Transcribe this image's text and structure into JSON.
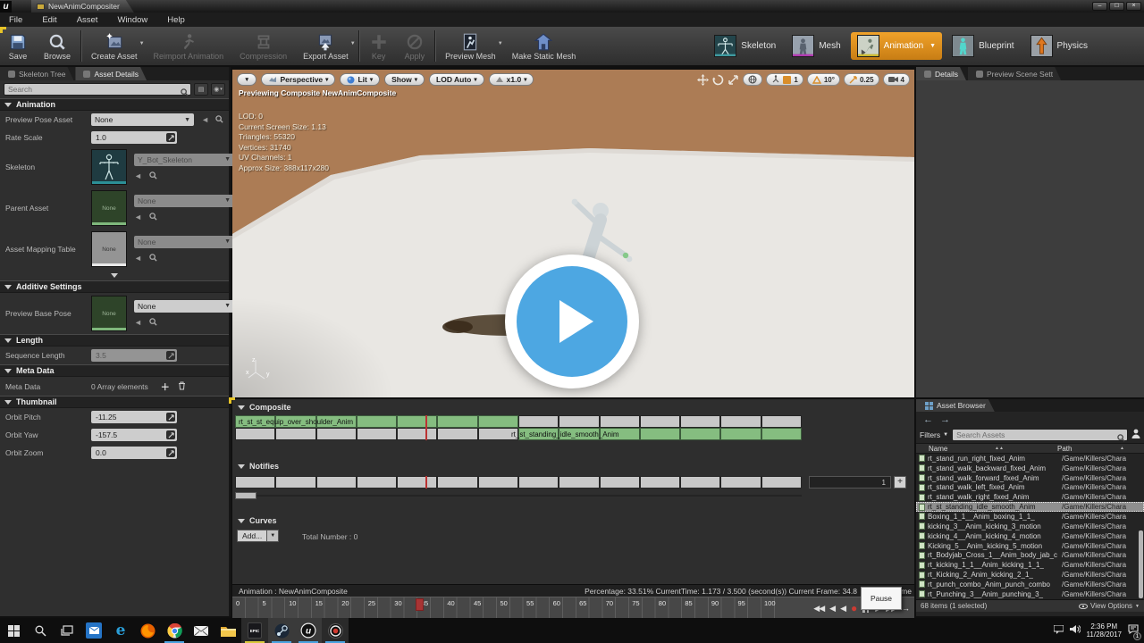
{
  "window": {
    "title": "NewAnimCompositer",
    "menu": [
      "File",
      "Edit",
      "Asset",
      "Window",
      "Help"
    ],
    "controls": {
      "minimize": "–",
      "maximize": "□",
      "close": "×"
    }
  },
  "toolbar": {
    "items": [
      {
        "label": "Save",
        "icon": "save-icon",
        "disabled": false,
        "caret": false,
        "sep_after": false
      },
      {
        "label": "Browse",
        "icon": "browse-icon",
        "disabled": false,
        "caret": false,
        "sep_after": true
      },
      {
        "label": "Create Asset",
        "icon": "create-asset-icon",
        "disabled": false,
        "caret": true,
        "sep_after": false
      },
      {
        "label": "Reimport Animation",
        "icon": "reimport-icon",
        "disabled": true,
        "caret": false,
        "sep_after": false
      },
      {
        "label": "Compression",
        "icon": "compression-icon",
        "disabled": true,
        "caret": false,
        "sep_after": false
      },
      {
        "label": "Export Asset",
        "icon": "export-asset-icon",
        "disabled": false,
        "caret": true,
        "sep_after": true
      },
      {
        "label": "Key",
        "icon": "key-icon",
        "disabled": true,
        "caret": false,
        "sep_after": false
      },
      {
        "label": "Apply",
        "icon": "apply-icon",
        "disabled": true,
        "caret": false,
        "sep_after": true
      },
      {
        "label": "Preview Mesh",
        "icon": "preview-mesh-icon",
        "disabled": false,
        "caret": true,
        "sep_after": false
      },
      {
        "label": "Make Static Mesh",
        "icon": "static-mesh-icon",
        "disabled": false,
        "caret": false,
        "sep_after": false
      }
    ],
    "modes": [
      {
        "label": "Skeleton",
        "icon": "skeleton-tile",
        "active": false,
        "caret": false
      },
      {
        "label": "Mesh",
        "icon": "mesh-tile",
        "active": false,
        "caret": false
      },
      {
        "label": "Animation",
        "icon": "animation-tile",
        "active": true,
        "caret": true
      },
      {
        "label": "Blueprint",
        "icon": "blueprint-tile",
        "active": false,
        "caret": false
      },
      {
        "label": "Physics",
        "icon": "physics-tile",
        "active": false,
        "caret": false
      }
    ],
    "accent_orange": "#e8920f"
  },
  "left_panel": {
    "tabs": [
      {
        "label": "Skeleton Tree",
        "active": false
      },
      {
        "label": "Asset Details",
        "active": true
      }
    ],
    "search_placeholder": "Search",
    "sections": {
      "animation": {
        "title": "Animation",
        "preview_pose_asset": {
          "label": "Preview Pose Asset",
          "value": "None"
        },
        "rate_scale": {
          "label": "Rate Scale",
          "value": "1.0"
        },
        "skeleton": {
          "label": "Skeleton",
          "value": "Y_Bot_Skeleton"
        },
        "parent_asset": {
          "label": "Parent Asset",
          "value": "None",
          "thumb": "None"
        },
        "asset_mapping_table": {
          "label": "Asset Mapping Table",
          "value": "None",
          "thumb": "None"
        }
      },
      "additive": {
        "title": "Additive Settings",
        "preview_base_pose": {
          "label": "Preview Base Pose",
          "value": "None",
          "thumb": "None"
        }
      },
      "length": {
        "title": "Length",
        "sequence_length": {
          "label": "Sequence Length",
          "value": "3.5"
        }
      },
      "meta": {
        "title": "Meta Data",
        "meta_data": {
          "label": "Meta Data",
          "value": "0 Array elements"
        }
      },
      "thumbnail": {
        "title": "Thumbnail",
        "orbit_pitch": {
          "label": "Orbit Pitch",
          "value": "-11.25"
        },
        "orbit_yaw": {
          "label": "Orbit Yaw",
          "value": "-157.5"
        },
        "orbit_zoom": {
          "label": "Orbit Zoom",
          "value": "0.0"
        }
      }
    }
  },
  "viewport": {
    "buttons": [
      "Perspective",
      "Lit",
      "Show",
      "LOD Auto",
      "x1.0"
    ],
    "overlay_title": "Previewing Composite NewAnimComposite",
    "stats": [
      "LOD: 0",
      "Current Screen Size: 1.13",
      "Triangles: 55320",
      "Vertices: 31740",
      "UV Channels: 1",
      "Approx Size: 388x117x280"
    ],
    "snaps": {
      "grid": "1",
      "angle": "10°",
      "scale": "0.25",
      "camera": "4"
    },
    "wall_color": "#ac7c55",
    "floor_color": "#e9e7e3",
    "play_blue": "#4da7e2"
  },
  "composite": {
    "title": "Composite",
    "segments": [
      {
        "name": "rt_st_equip_over_shoulder_Anim",
        "full": "rt_st_st_equip_over_shoulder_Anim"
      },
      {
        "name": "rt_st_standing_idle_smooth_Anim"
      }
    ],
    "green_color": "#85bd80",
    "notifies_title": "Notifies",
    "notify_track_value": "1",
    "notify_add": "+",
    "curves_title": "Curves",
    "add_button": "Add...",
    "total_label": "Total Number : 0",
    "status_left": "Animation : NewAnimComposite",
    "status_right": "Percentage:  33.51% CurrentTime:  1.173 / 3.500 (second(s)) Current Frame:  34.8",
    "status_suffix": "ame",
    "pause_tooltip": "Pause",
    "timeline_ticks": [
      0,
      5,
      10,
      15,
      20,
      25,
      30,
      35,
      40,
      45,
      50,
      55,
      60,
      65,
      70,
      75,
      80,
      85,
      90,
      95,
      100
    ]
  },
  "right_panel": {
    "tabs": [
      {
        "label": "Details",
        "active": true
      },
      {
        "label": "Preview Scene Sett",
        "active": false
      }
    ]
  },
  "asset_browser": {
    "tab": "Asset Browser",
    "filters_label": "Filters",
    "search_placeholder": "Search Assets",
    "columns": [
      "Name",
      "Path"
    ],
    "rows": [
      {
        "name": "rt_stand_run_right_fixed_Anim",
        "path": "/Game/Killers/Chara"
      },
      {
        "name": "rt_stand_walk_backward_fixed_Anim",
        "path": "/Game/Killers/Chara"
      },
      {
        "name": "rt_stand_walk_forward_fixed_Anim",
        "path": "/Game/Killers/Chara"
      },
      {
        "name": "rt_stand_walk_left_fixed_Anim",
        "path": "/Game/Killers/Chara"
      },
      {
        "name": "rt_stand_walk_right_fixed_Anim",
        "path": "/Game/Killers/Chara"
      },
      {
        "name": "rt_st_standing_idle_smooth_Anim",
        "path": "/Game/Killers/Chara"
      },
      {
        "name": "Boxing_1_1__Anim_boxing_1_1_",
        "path": "/Game/Killers/Chara"
      },
      {
        "name": "kicking_3__Anim_kicking_3_motion",
        "path": "/Game/Killers/Chara"
      },
      {
        "name": "kicking_4__Anim_kicking_4_motion",
        "path": "/Game/Killers/Chara"
      },
      {
        "name": "Kicking_5__Anim_kicking_5_motion",
        "path": "/Game/Killers/Chara"
      },
      {
        "name": "rt_Bodyjab_Cross_1__Anim_body_jab_c",
        "path": "/Game/Killers/Chara"
      },
      {
        "name": "rt_kicking_1_1__Anim_kicking_1_1_",
        "path": "/Game/Killers/Chara"
      },
      {
        "name": "rt_Kicking_2_Anim_kicking_2_1_",
        "path": "/Game/Killers/Chara"
      },
      {
        "name": "rt_punch_combo_Anim_punch_combo",
        "path": "/Game/Killers/Chara"
      },
      {
        "name": "rt_Punching_3__Anim_punching_3_",
        "path": "/Game/Killers/Chara"
      }
    ],
    "selected_index": 5,
    "footer": "68 items (1 selected)",
    "view_options": "View Options"
  },
  "taskbar": {
    "time": "2:36 PM",
    "date": "11/28/2017",
    "badge": "1",
    "epic_label": "EPIC"
  }
}
